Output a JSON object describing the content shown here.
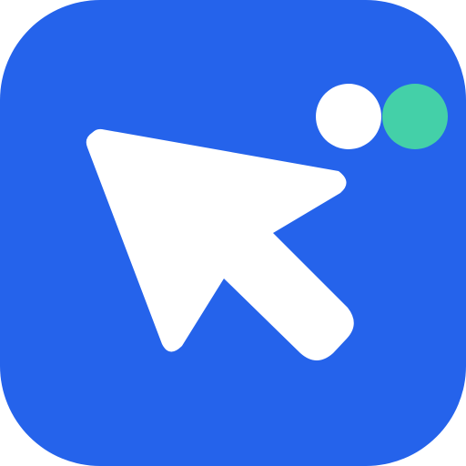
{
  "icon": {
    "name": "cursor-app-icon",
    "background_color": "#2563EB",
    "cursor_color": "#FFFFFF",
    "dot_primary_color": "#FFFFFF",
    "dot_secondary_color": "#44D0A8"
  }
}
